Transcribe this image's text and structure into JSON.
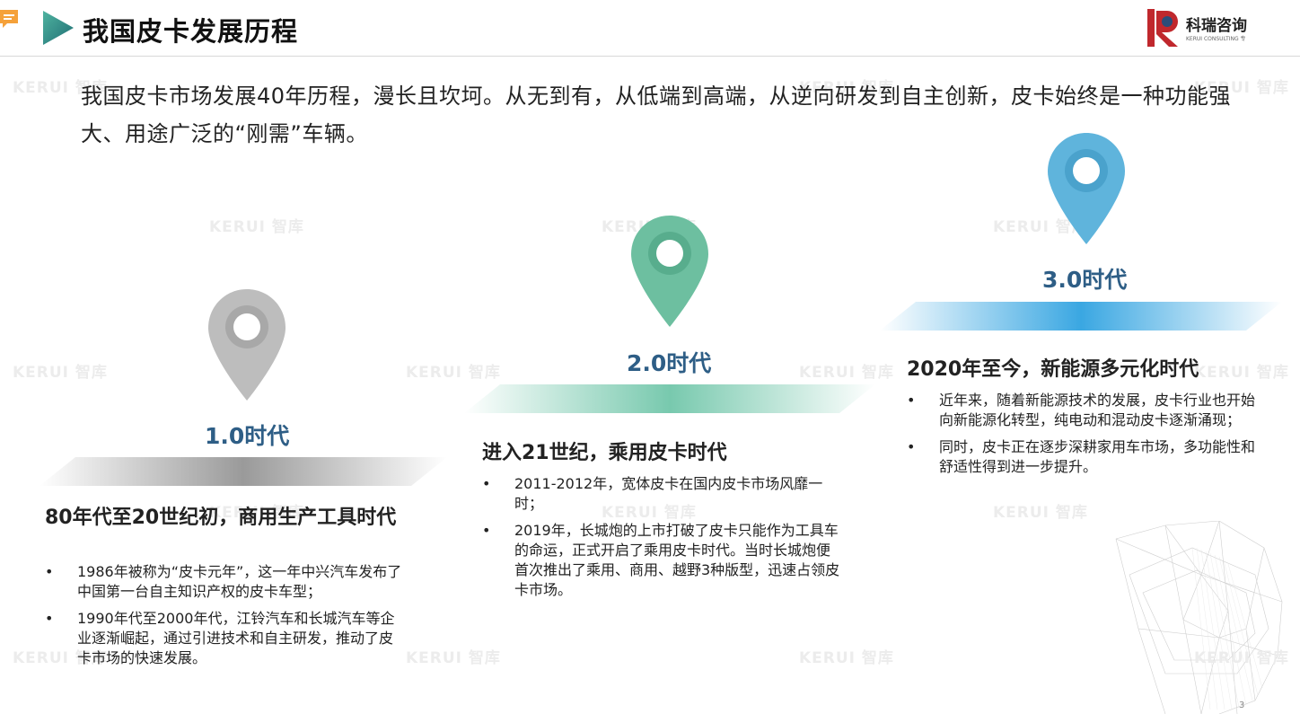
{
  "header": {
    "title": "我国皮卡发展历程",
    "logo_name": "科瑞咨询",
    "logo_sub": "KERUI CONSULTING 专业服务咨询供应商"
  },
  "watermark": {
    "text": "KERUI 智库"
  },
  "intro": "我国皮卡市场发展40年历程，漫长且坎坷。从无到有，从低端到高端，从逆向研发到自主创新，皮卡始终是一种功能强大、用途广泛的“刚需”车辆。",
  "eras": [
    {
      "label": "1.0时代",
      "heading": "80年代至20世纪初，商用生产工具时代",
      "bullets": [
        "1986年被称为“皮卡元年”，这一年中兴汽车发布了中国第一台自主知识产权的皮卡车型；",
        "1990年代至2000年代，江铃汽车和长城汽车等企业逐渐崛起，通过引进技术和自主研发，推动了皮卡市场的快速发展。"
      ],
      "color": "#bdbdbd"
    },
    {
      "label": "2.0时代",
      "heading": "进入21世纪，乘用皮卡时代",
      "bullets": [
        "2011-2012年，宽体皮卡在国内皮卡市场风靡一时；",
        "2019年，长城炮的上市打破了皮卡只能作为工具车的命运，正式开启了乘用皮卡时代。当时长城炮便首次推出了乘用、商用、越野3种版型，迅速占领皮卡市场。"
      ],
      "color": "#6dbfa0"
    },
    {
      "label": "3.0时代",
      "heading": "2020年至今，新能源多元化时代",
      "bullets": [
        "近年来，随着新能源技术的发展，皮卡行业也开始向新能源化转型，纯电动和混动皮卡逐渐涌现；",
        "同时，皮卡正在逐步深耕家用车市场，多功能性和舒适性得到进一步提升。"
      ],
      "color": "#5fb4dc"
    }
  ],
  "bullet_char": "•",
  "page_number": "3",
  "colors": {
    "title_arrow": "#2a8f84",
    "era_text": "#2e5e86",
    "logo_red": "#c0282d"
  }
}
